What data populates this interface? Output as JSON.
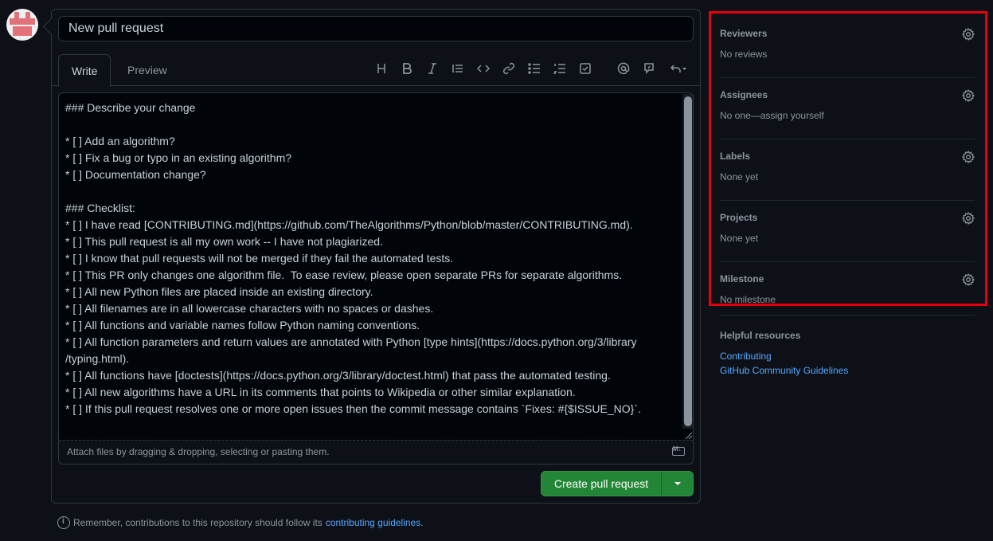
{
  "user": {
    "avatar": "identicon-avatar"
  },
  "pull_request": {
    "title_value": "New pull request",
    "tabs": [
      {
        "label": "Write",
        "active": true
      },
      {
        "label": "Preview",
        "active": false
      }
    ],
    "toolbar_icons": [
      "heading-icon",
      "bold-icon",
      "italic-icon",
      "quote-icon",
      "code-icon",
      "link-icon",
      "bullet-list-icon",
      "numbered-list-icon",
      "task-list-icon",
      "mention-icon",
      "reference-icon",
      "undo-icon"
    ],
    "body": "### Describe your change\n\n* [ ] Add an algorithm?\n* [ ] Fix a bug or typo in an existing algorithm?\n* [ ] Documentation change?\n\n### Checklist:\n* [ ] I have read [CONTRIBUTING.md](https://github.com/TheAlgorithms/Python/blob/master/CONTRIBUTING.md).\n* [ ] This pull request is all my own work -- I have not plagiarized.\n* [ ] I know that pull requests will not be merged if they fail the automated tests.\n* [ ] This PR only changes one algorithm file.  To ease review, please open separate PRs for separate algorithms.\n* [ ] All new Python files are placed inside an existing directory.\n* [ ] All filenames are in all lowercase characters with no spaces or dashes.\n* [ ] All functions and variable names follow Python naming conventions.\n* [ ] All function parameters and return values are annotated with Python [type hints](https://docs.python.org/3/library\n/typing.html).\n* [ ] All functions have [doctests](https://docs.python.org/3/library/doctest.html) that pass the automated testing.\n* [ ] All new algorithms have a URL in its comments that points to Wikipedia or other similar explanation.\n* [ ] If this pull request resolves one or more open issues then the commit message contains `Fixes: #{$ISSUE_NO}`.",
    "attach_text": "Attach files by dragging & dropping, selecting or pasting them.",
    "markdown_icon": "markdown-icon",
    "create_button_label": "Create pull request",
    "note_text": "Remember, contributions to this repository should follow its",
    "note_link": "contributing guidelines",
    "note_suffix": "."
  },
  "sidebar": {
    "sections": [
      {
        "title": "Reviewers",
        "value": "No reviews"
      },
      {
        "title": "Assignees",
        "value": "No one—assign yourself"
      },
      {
        "title": "Labels",
        "value": "None yet"
      },
      {
        "title": "Projects",
        "value": "None yet"
      },
      {
        "title": "Milestone",
        "value": "No milestone"
      }
    ],
    "highlight_color": "#e6000d"
  },
  "helpful_resources": {
    "title": "Helpful resources",
    "links": [
      "Contributing",
      "GitHub Community Guidelines"
    ]
  },
  "colors": {
    "background": "#0d1117",
    "accent_link": "#58a6ff",
    "primary_button": "#238636"
  }
}
